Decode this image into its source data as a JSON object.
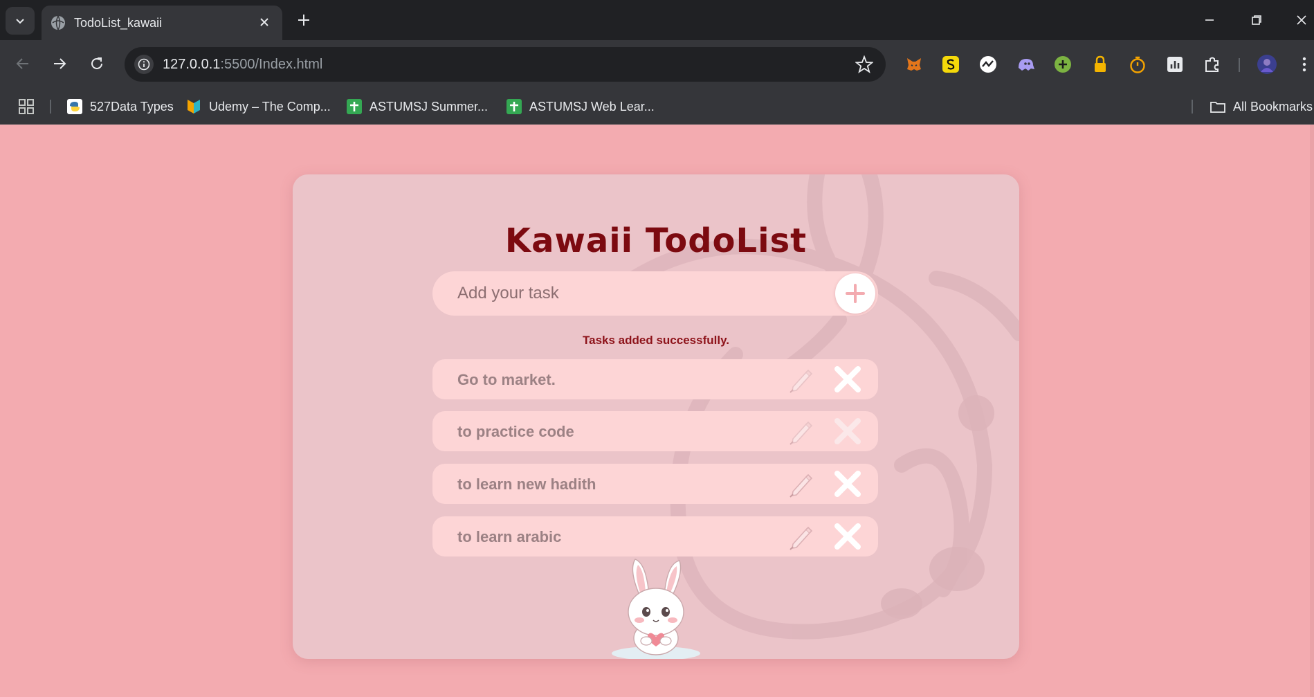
{
  "browser": {
    "tab": {
      "title": "TodoList_kawaii"
    },
    "url": {
      "host": "127.0.0.1",
      "path": ":5500/Index.html"
    },
    "bookmarks": [
      {
        "label": "527Data Types",
        "icon": "python-icon"
      },
      {
        "label": "Udemy – The Comp...",
        "icon": "udemy-icon"
      },
      {
        "label": "ASTUMSJ Summer...",
        "icon": "sheets-icon"
      },
      {
        "label": "ASTUMSJ Web Lear...",
        "icon": "sheets-icon"
      }
    ],
    "all_bookmarks_label": "All Bookmarks"
  },
  "app": {
    "title": "Kawaii TodoList",
    "input_placeholder": "Add your task",
    "status_message": "Tasks added successfully.",
    "tasks": [
      {
        "text": "Go to market."
      },
      {
        "text": "to practice code"
      },
      {
        "text": "to learn new hadith"
      },
      {
        "text": "to learn arabic"
      }
    ]
  },
  "colors": {
    "page_background": "#f3abb0",
    "title": "#7c0a10",
    "status": "#8d1219",
    "task_background": "#fdd5d6"
  }
}
